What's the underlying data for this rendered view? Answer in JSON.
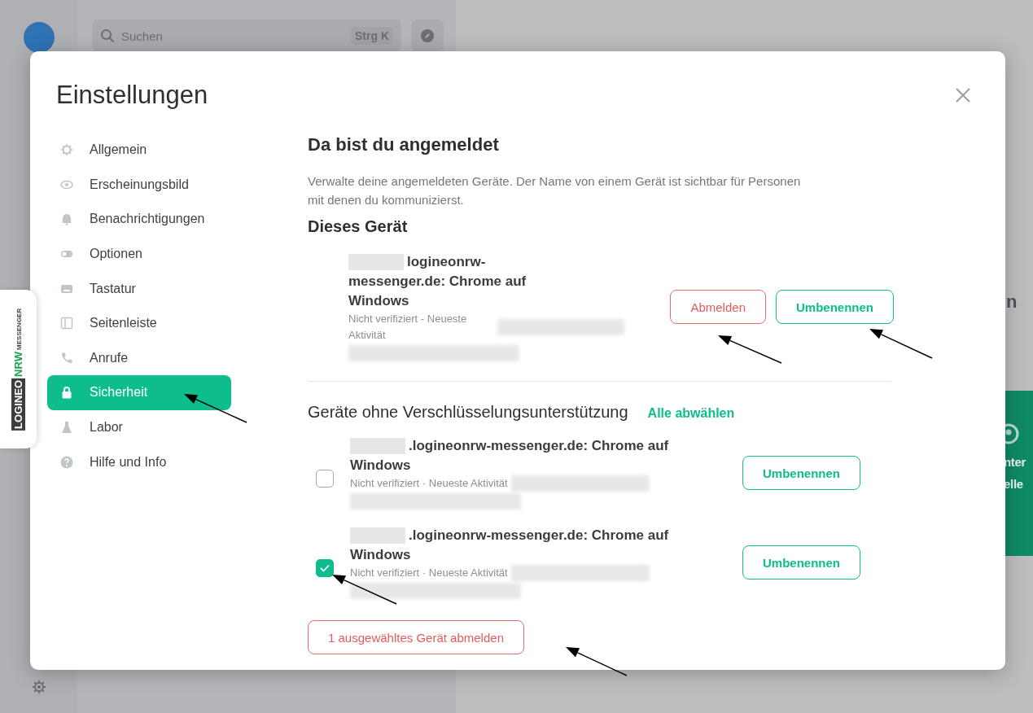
{
  "app": {
    "search": {
      "placeholder": "Suchen",
      "shortcut": "Strg K"
    },
    "background_texts": [
      "n",
      "nter",
      "elle"
    ]
  },
  "logo": {
    "text_1": "LOGINEO",
    "text_2": "NRW",
    "text_3": "MESSENGER"
  },
  "dialog": {
    "title": "Einstellungen",
    "nav": [
      {
        "label": "Allgemein",
        "selected": false
      },
      {
        "label": "Erscheinungsbild",
        "selected": false
      },
      {
        "label": "Benachrichtigungen",
        "selected": false
      },
      {
        "label": "Optionen",
        "selected": false
      },
      {
        "label": "Tastatur",
        "selected": false
      },
      {
        "label": "Seitenleiste",
        "selected": false
      },
      {
        "label": "Anrufe",
        "selected": false
      },
      {
        "label": "Sicherheit",
        "selected": true
      },
      {
        "label": "Labor",
        "selected": false
      },
      {
        "label": "Hilfe und Info",
        "selected": false
      }
    ],
    "heading": "Da bist du angemeldet",
    "description": "Verwalte deine angemeldeten Geräte. Der Name von einem Gerät ist sichtbar für Personen mit denen du kommunizierst.",
    "this_device": {
      "heading": "Dieses Gerät",
      "name": "logineonrw-messenger.de: Chrome auf Windows",
      "meta": "Nicht verifiziert - Neueste Aktivität",
      "actions": [
        {
          "label": "Abmelden",
          "kind": "danger"
        },
        {
          "label": "Umbenennen",
          "kind": "primary"
        }
      ]
    },
    "unsupported": {
      "heading": "Geräte ohne Verschlüsselungsunterstützung",
      "deselect_all": "Alle abwählen",
      "devices": [
        {
          "name": ".logineonrw-messenger.de: Chrome auf Windows",
          "meta": "Nicht verifiziert · Neueste Aktivität",
          "checked": false,
          "action": "Umbenennen"
        },
        {
          "name": ".logineonrw-messenger.de: Chrome auf Windows",
          "meta": "Nicht verifiziert · Neueste Aktivität",
          "checked": true,
          "action": "Umbenennen"
        }
      ]
    },
    "signout_selected": "1 ausgewähltes Gerät abmelden"
  }
}
